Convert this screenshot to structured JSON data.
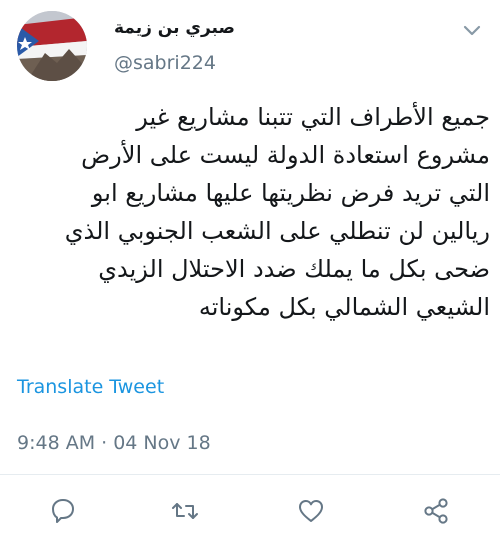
{
  "tweet": {
    "author": {
      "display_name": "صبري بن زيمة",
      "handle": "@sabri224"
    },
    "text": "جميع الأطراف التي تتبنا مشاريع غير\nمشروع استعادة الدولة ليست على الأرض\nالتي تريد فرض نظريتها عليها مشاريع ابو\nريالين لن تنطلي على الشعب الجنوبي الذي\nضحى بكل ما يملك ضدد الاحتلال الزيدي\nالشيعي الشمالي بكل مكوناته",
    "translate_label": "Translate Tweet",
    "timestamp": "9:48 AM · 04 Nov 18"
  },
  "icons": {
    "menu": "chevron-down-icon",
    "reply": "reply-icon",
    "retweet": "retweet-icon",
    "like": "heart-icon",
    "share": "share-icon"
  },
  "colors": {
    "text": "#14171a",
    "secondary": "#657786",
    "link": "#1b95e0",
    "icon": "#657786"
  }
}
